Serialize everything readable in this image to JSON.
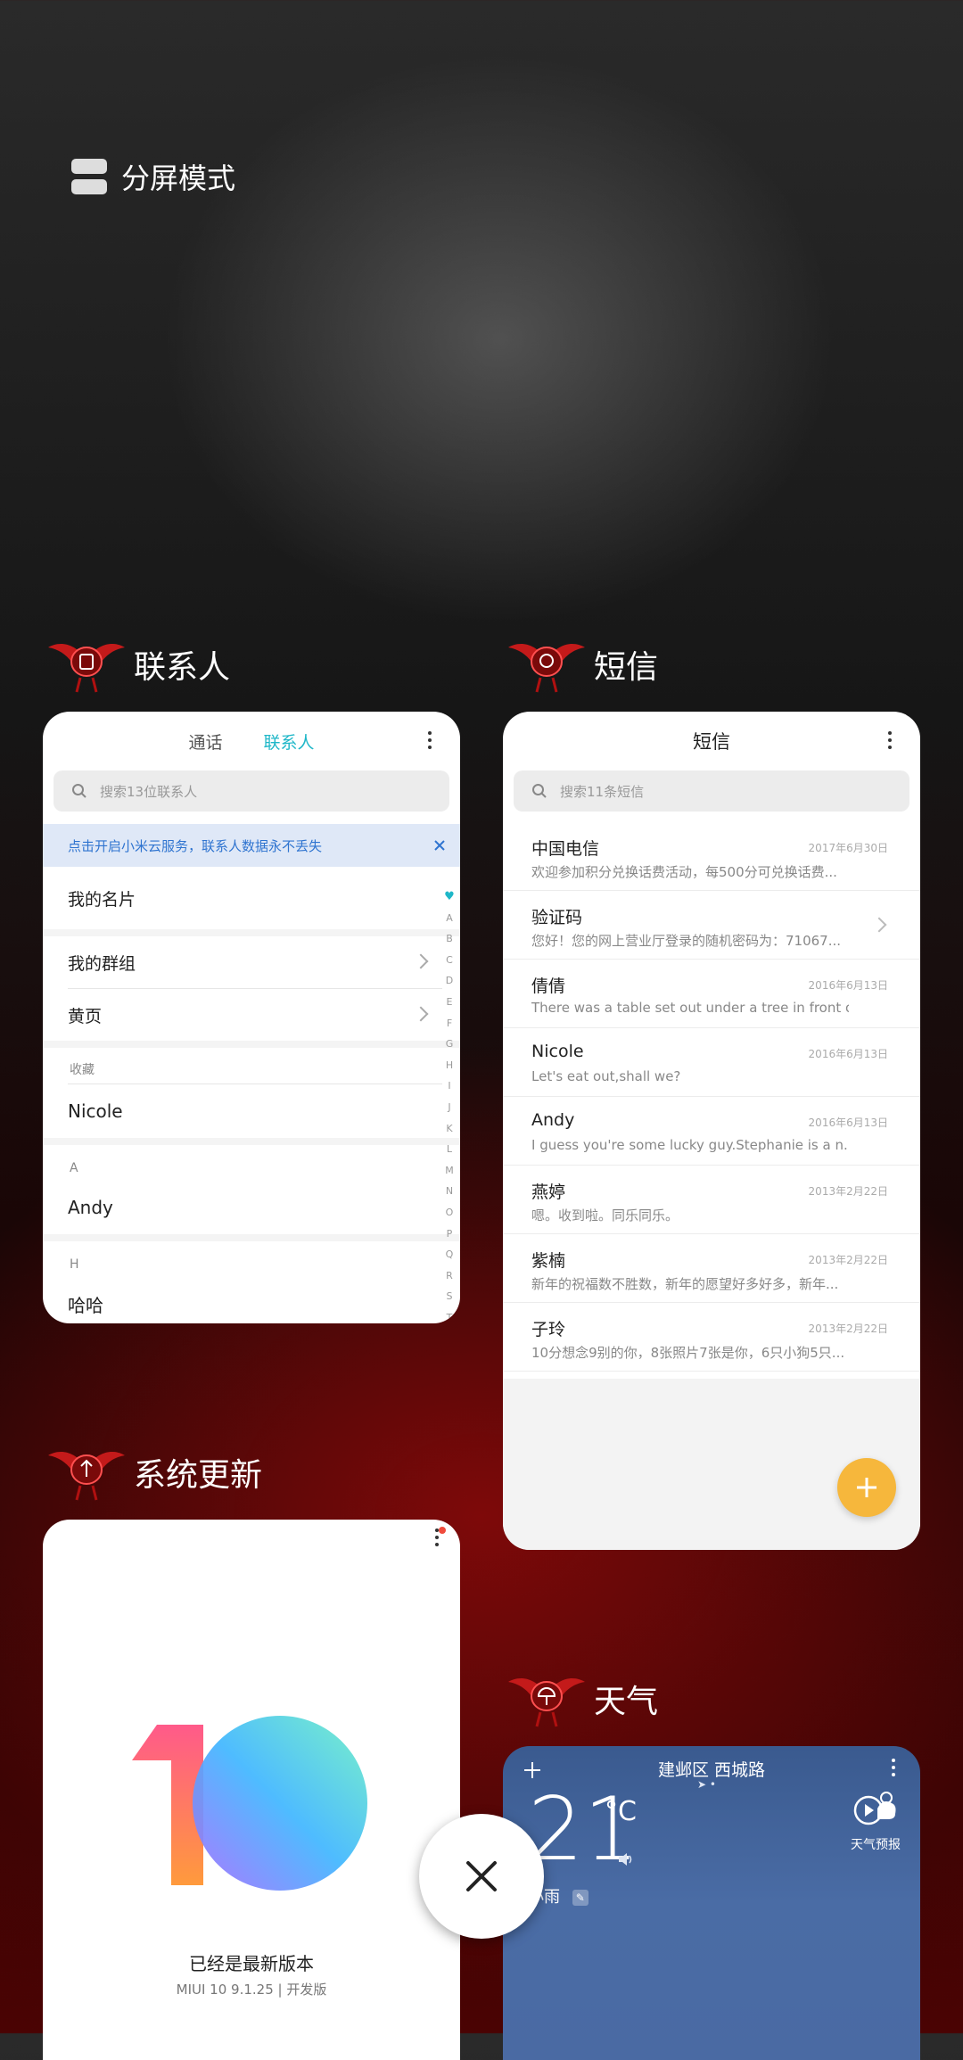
{
  "split_screen": {
    "label": "分屏模式",
    "icon": "split-screen-icon"
  },
  "apps": {
    "contacts": {
      "title": "联系人",
      "tabs": [
        "通话",
        "联系人"
      ],
      "active_tab": "联系人",
      "search_placeholder": "搜索13位联系人",
      "banner": "点击开启小米云服务，联系人数据永不丢失",
      "my_card": "我的名片",
      "groups": "我的群组",
      "yellow_pages": "黄页",
      "section_favorites": "收藏",
      "favorite_contact": "Nicole",
      "section_a": "A",
      "contact_a": "Andy",
      "section_h": "H",
      "contact_h": "哈哈",
      "alphabet": [
        "A",
        "B",
        "C",
        "D",
        "E",
        "F",
        "G",
        "H",
        "I",
        "J",
        "K",
        "L",
        "M",
        "N",
        "O",
        "P",
        "Q",
        "R",
        "S",
        "T"
      ]
    },
    "sms": {
      "title": "短信",
      "header": "短信",
      "search_placeholder": "搜索11条短信",
      "messages": [
        {
          "name": "中国电信",
          "date": "2017年6月30日",
          "preview": "欢迎参加积分兑换话费活动，每500分可兑换话费..."
        },
        {
          "name": "验证码",
          "date": "",
          "preview": "您好！您的网上营业厅登录的随机密码为：71067..."
        },
        {
          "name": "倩倩",
          "date": "2016年6月13日",
          "preview": "There was a table set out under a tree in front o..."
        },
        {
          "name": "Nicole",
          "date": "2016年6月13日",
          "preview": "Let's eat out,shall we?"
        },
        {
          "name": "Andy",
          "date": "2016年6月13日",
          "preview": "I guess you're some lucky guy.Stephanie is a n..."
        },
        {
          "name": "燕婷",
          "date": "2013年2月22日",
          "preview": "嗯。收到啦。同乐同乐。"
        },
        {
          "name": "紫楠",
          "date": "2013年2月22日",
          "preview": "新年的祝福数不胜数，新年的愿望好多好多，新年..."
        },
        {
          "name": "子玲",
          "date": "2013年2月22日",
          "preview": "10分想念9别的你，8张照片7张是你，6只小狗5只..."
        }
      ]
    },
    "update": {
      "title": "系统更新",
      "status": "已经是最新版本",
      "version": "MIUI 10 9.1.25 | 开发版"
    },
    "weather": {
      "title": "天气",
      "location": "建邺区 西城路",
      "temperature": "21",
      "unit": "°C",
      "condition": "小雨",
      "forecast_label": "天气预报"
    }
  },
  "colors": {
    "accent_teal": "#1fb7c8",
    "fab_orange": "#f6b73c",
    "banner_blue": "#2f74d0"
  }
}
